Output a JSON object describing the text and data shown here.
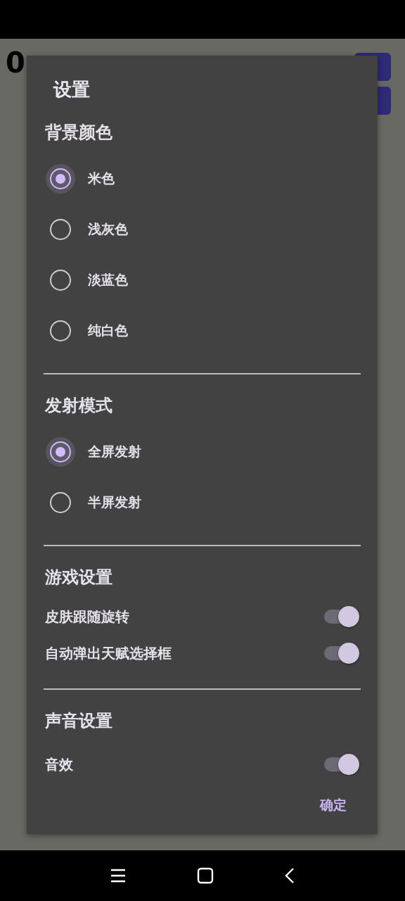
{
  "background": {
    "score": "0"
  },
  "dialog": {
    "title": "设置",
    "sections": [
      {
        "kind": "radio",
        "title": "背景颜色",
        "options": [
          {
            "label": "米色",
            "selected": true
          },
          {
            "label": "浅灰色",
            "selected": false
          },
          {
            "label": "淡蓝色",
            "selected": false
          },
          {
            "label": "纯白色",
            "selected": false
          }
        ]
      },
      {
        "kind": "radio",
        "title": "发射模式",
        "options": [
          {
            "label": "全屏发射",
            "selected": true
          },
          {
            "label": "半屏发射",
            "selected": false
          }
        ]
      },
      {
        "kind": "switch",
        "title": "游戏设置",
        "options": [
          {
            "label": "皮肤跟随旋转",
            "on": true
          },
          {
            "label": "自动弹出天赋选择框",
            "on": true
          }
        ]
      },
      {
        "kind": "switch",
        "title": "声音设置",
        "options": [
          {
            "label": "音效",
            "on": true
          }
        ]
      }
    ],
    "confirm": "确定"
  }
}
